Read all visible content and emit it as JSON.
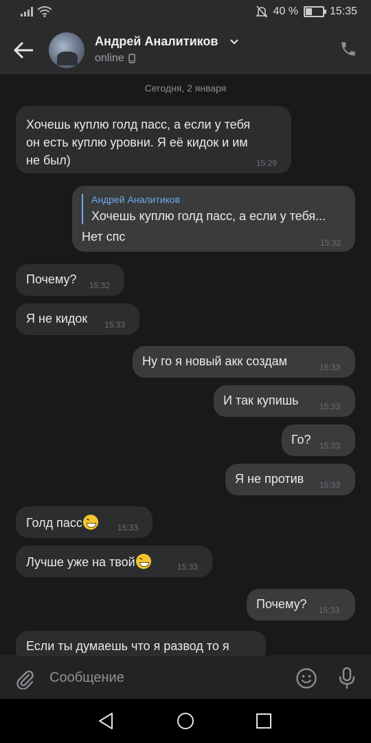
{
  "status_bar": {
    "battery_percent": "40 %",
    "time": "15:35"
  },
  "header": {
    "contact_name": "Андрей Аналитиков",
    "status": "online"
  },
  "chat": {
    "date_separator": "Сегодня, 2 января",
    "messages": [
      {
        "direction": "in",
        "lines": [
          "Хочешь куплю голд пасс, а если у тебя",
          "он есть куплю уровни. Я её кидок и им",
          "не был)"
        ],
        "time": "15:29"
      },
      {
        "direction": "out",
        "reply_to_name": "Андрей Аналитиков",
        "reply_to_text": "Хочешь куплю голд пасс, а если у тебя...",
        "text": "Нет спс",
        "time": "15:32"
      },
      {
        "direction": "in",
        "text": "Почему?",
        "time": "15:32"
      },
      {
        "direction": "in",
        "text": "Я не кидок",
        "time": "15:33"
      },
      {
        "direction": "out",
        "text": "Ну го я новый акк создам",
        "time": "15:33"
      },
      {
        "direction": "out",
        "text": "И так купишь",
        "time": "15:33"
      },
      {
        "direction": "out",
        "text": "Го?",
        "time": "15:33"
      },
      {
        "direction": "out",
        "text": "Я не против",
        "time": "15:33"
      },
      {
        "direction": "in",
        "text": "Голд пасс",
        "emoji": "grinning-squinting-face",
        "time": "15:33"
      },
      {
        "direction": "in",
        "text": "Лучше уже на твой",
        "emoji": "grinning-squinting-face",
        "time": "15:33"
      },
      {
        "direction": "out",
        "text": "Почему?",
        "time": "15:33"
      },
      {
        "direction": "in",
        "text": "Если ты думаешь что я развод то я"
      }
    ]
  },
  "composer": {
    "placeholder": "Сообщение"
  },
  "icons": {
    "back": "arrow-left-icon",
    "phone": "phone-icon",
    "attach": "paperclip-icon",
    "emoji": "smiley-icon",
    "mic": "microphone-icon",
    "name_chevron": "chevron-down-icon",
    "device": "mobile-device-icon"
  },
  "colors": {
    "background": "#19191a",
    "bubble_in": "#2c2d2e",
    "bubble_out": "#3a3b3c",
    "accent": "#71aaeb"
  }
}
